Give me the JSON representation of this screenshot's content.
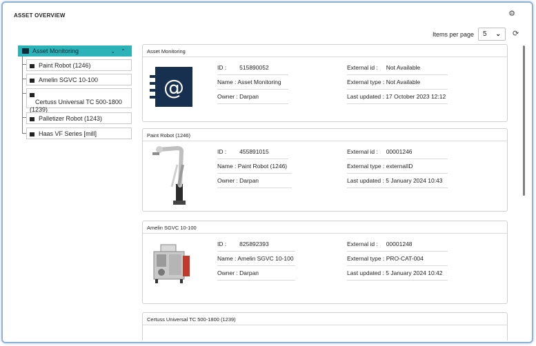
{
  "app": {
    "title": "ASSET OVERVIEW",
    "settings_icon": "gear-icon"
  },
  "pagination": {
    "label": "Items per page",
    "value": "5",
    "refresh_icon": "refresh-icon"
  },
  "tree": {
    "root": {
      "label": "Asset Monitoring",
      "icon": "folder-icon"
    },
    "items": [
      {
        "label": "Paint Robot (1246)"
      },
      {
        "label": "Amelin SGVC 10-100"
      },
      {
        "label": "Certuss Universal TC 500-1800 (1239)"
      },
      {
        "label": "Palletizer Robot (1243)"
      },
      {
        "label": "Haas VF Series [mill]"
      }
    ]
  },
  "cards": [
    {
      "title": "Asset Monitoring",
      "id_label": "ID :",
      "id": "515890052",
      "name_label": "Name :",
      "name": "Asset Monitoring",
      "owner_label": "Owner :",
      "owner": "Darpan",
      "ext_id_label": "External id :",
      "ext_id": "Not Available",
      "ext_type_label": "External type :",
      "ext_type": "Not Available",
      "updated_label": "Last updated :",
      "updated": "17 October 2023 12:12"
    },
    {
      "title": "Paint Robot (1246)",
      "id_label": "ID :",
      "id": "455891015",
      "name_label": "Name :",
      "name": "Paint Robot (1246)",
      "owner_label": "Owner :",
      "owner": "Darpan",
      "ext_id_label": "External id :",
      "ext_id": "00001246",
      "ext_type_label": "External type :",
      "ext_type": "externalID",
      "updated_label": "Last updated :",
      "updated": "5 January 2024 10:43"
    },
    {
      "title": "Amelin SGVC 10-100",
      "id_label": "ID :",
      "id": "825892393",
      "name_label": "Name :",
      "name": "Amelin SGVC 10-100",
      "owner_label": "Owner :",
      "owner": "Darpan",
      "ext_id_label": "External id :",
      "ext_id": "00001248",
      "ext_type_label": "External type :",
      "ext_type": "PRO-CAT-004",
      "updated_label": "Last updated :",
      "updated": "5 January 2024 10:42"
    },
    {
      "title": "Certuss Universal TC 500-1800 (1239)"
    }
  ]
}
